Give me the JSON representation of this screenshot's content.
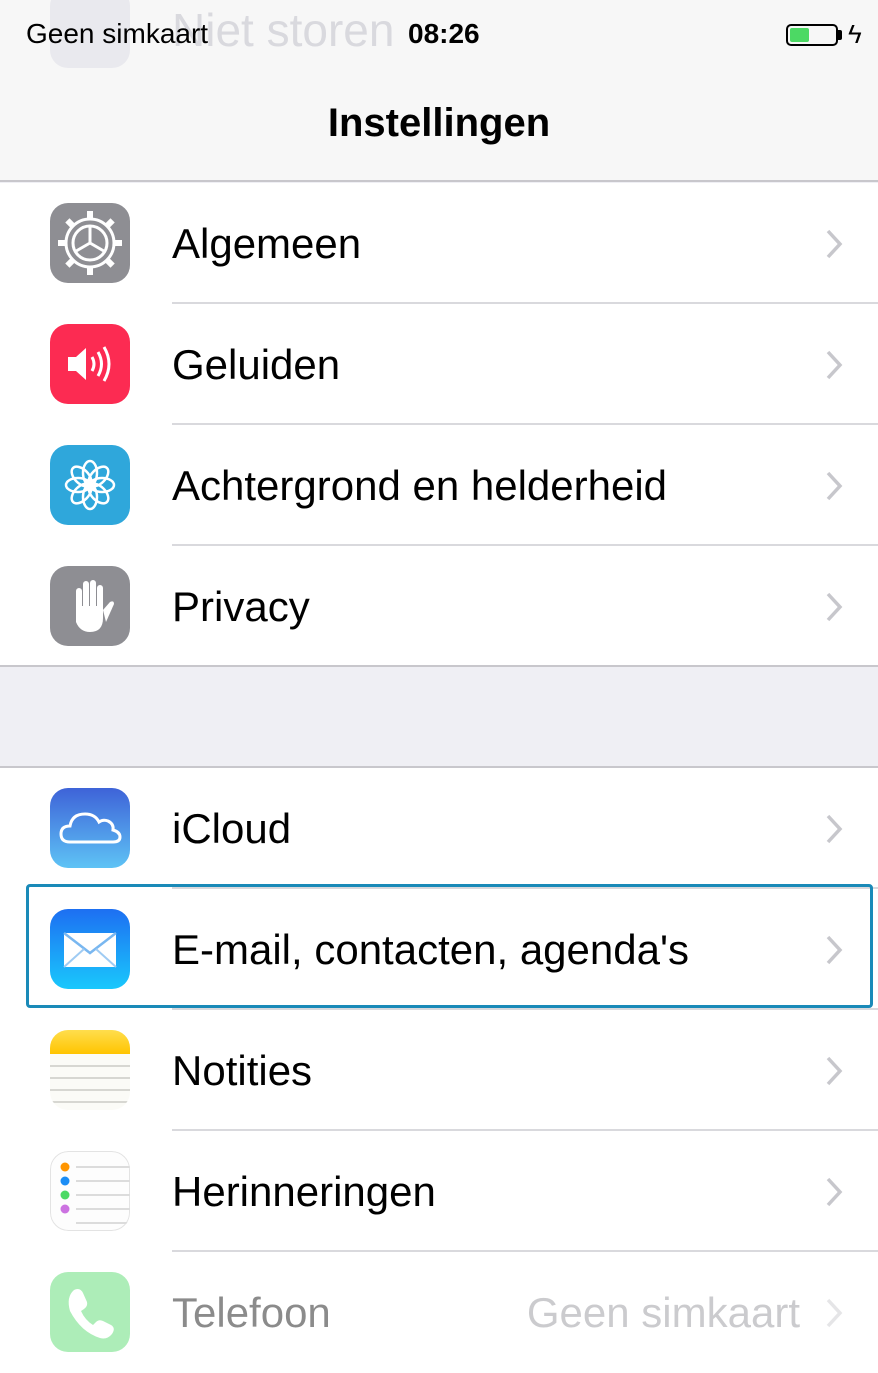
{
  "status_bar": {
    "carrier": "Geen simkaart",
    "time": "08:26",
    "battery_level": 0.44,
    "charging_icon": "bolt-icon",
    "ghost_row_label": "Niet storen"
  },
  "nav": {
    "title": "Instellingen"
  },
  "groups": [
    {
      "items": [
        {
          "label": "Algemeen",
          "icon": "gear-icon",
          "icon_color": "#8e8e93"
        },
        {
          "label": "Geluiden",
          "icon": "speaker-icon",
          "icon_color": "#fc2b52"
        },
        {
          "label": "Achtergrond en helderheid",
          "icon": "flower-icon",
          "icon_color": "#2fa7db"
        },
        {
          "label": "Privacy",
          "icon": "hand-icon",
          "icon_color": "#8e8e93"
        }
      ]
    },
    {
      "items": [
        {
          "label": "iCloud",
          "icon": "cloud-icon",
          "icon_color": "#4a8ff0"
        },
        {
          "label": "E-mail, contacten, agenda's",
          "icon": "envelope-icon",
          "icon_color": "#1b8df5",
          "highlighted": true
        },
        {
          "label": "Notities",
          "icon": "notes-icon",
          "icon_color": "#ffcc00"
        },
        {
          "label": "Herinneringen",
          "icon": "reminders-icon",
          "icon_color": "#ffffff"
        },
        {
          "label": "Telefoon",
          "detail": "Geen simkaart",
          "icon": "phone-icon",
          "icon_color": "#4cd964",
          "disabled": true
        }
      ]
    }
  ],
  "colors": {
    "highlight_border": "#1a8ab8",
    "separator": "#c8c7cc",
    "background": "#efeff4"
  }
}
